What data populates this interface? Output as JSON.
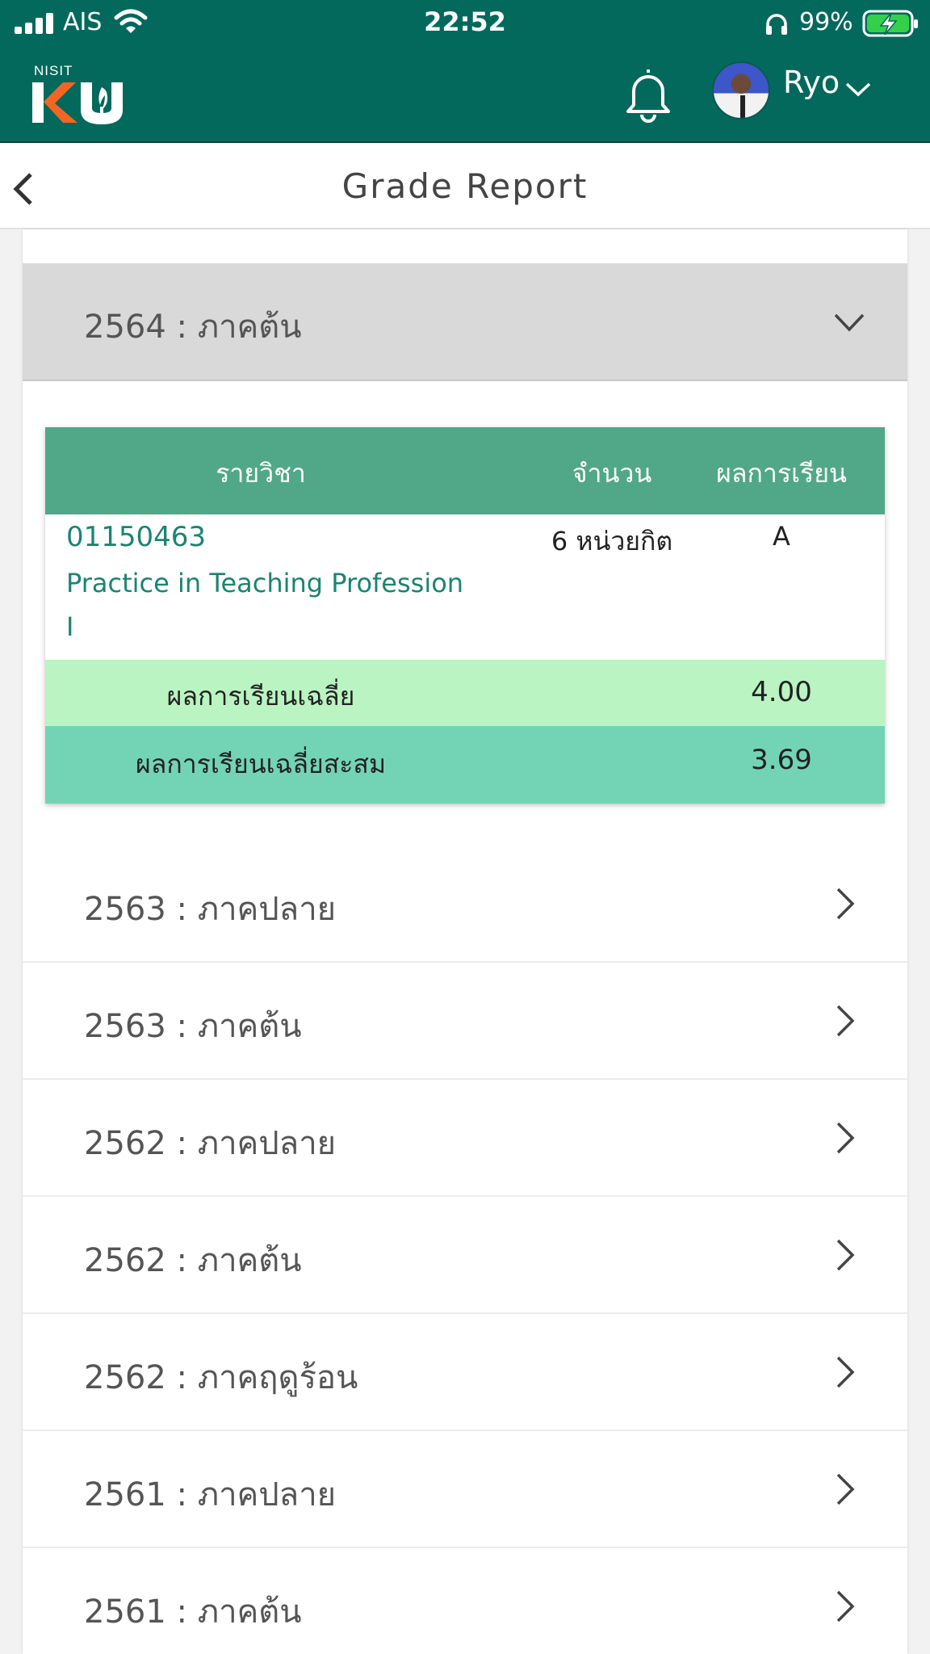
{
  "status_bar": {
    "carrier": "AIS",
    "time": "22:52",
    "battery": "99%"
  },
  "app_bar": {
    "logo_small": "NISIT",
    "user_name": "Ryo"
  },
  "title_bar": {
    "title": "Grade Report"
  },
  "open_semester": {
    "label": "2564 : ภาคต้น",
    "table": {
      "headers": [
        "รายวิชา",
        "จำนวน",
        "ผลการเรียน"
      ],
      "row": {
        "code": "01150463",
        "name": "Practice in Teaching Profession I",
        "credits": "6 หน่วยกิต",
        "grade": "A"
      },
      "gpa_label": "ผลการเรียนเฉลี่ย",
      "gpa_value": "4.00",
      "gpax_label": "ผลการเรียนเฉลี่ยสะสม",
      "gpax_value": "3.69"
    }
  },
  "semesters": [
    "2563 : ภาคปลาย",
    "2563 : ภาคต้น",
    "2562 : ภาคปลาย",
    "2562 : ภาคต้น",
    "2562 : ภาคฤดูร้อน",
    "2561 : ภาคปลาย",
    "2561 : ภาคต้น"
  ],
  "colors": {
    "header": "#02695c",
    "table_header": "#51a888",
    "gpa_row": "#baf4c2",
    "gpax_row": "#73d4b5",
    "logo_orange": "#f26522"
  }
}
